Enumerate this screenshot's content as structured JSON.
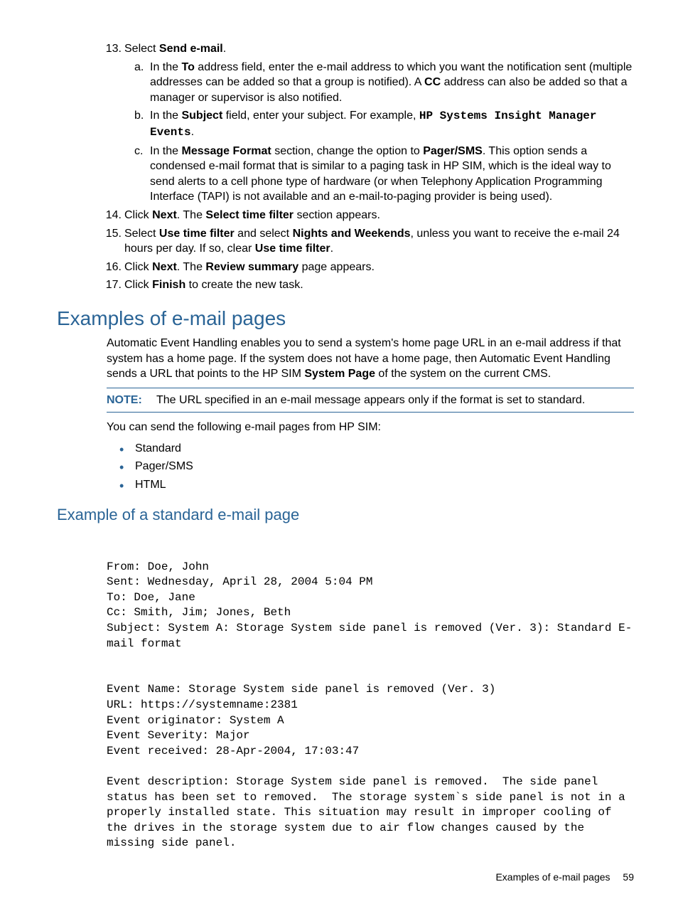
{
  "steps": {
    "s13": {
      "num": "13.",
      "t1": "Select ",
      "b1": "Send e-mail",
      "t2": ".",
      "a": {
        "num": "a.",
        "t1": "In the ",
        "b1": "To",
        "t2": " address field, enter the e-mail address to which you want the notification sent (multiple addresses can be added so that a group is notified). A ",
        "b2": "CC",
        "t3": " address can also be added so that a manager or supervisor is also notified."
      },
      "b": {
        "num": "b.",
        "t1": "In the ",
        "b1": "Subject",
        "t2": " field, enter your subject. For example, ",
        "m1": "HP Systems Insight Manager Events",
        "t3": "."
      },
      "c": {
        "num": "c.",
        "t1": "In the ",
        "b1": "Message Format",
        "t2": " section, change the option to ",
        "b2": "Pager/SMS",
        "t3": ". This option sends a condensed e-mail format that is similar to a paging task in HP SIM, which is the ideal way to send alerts to a cell phone type of hardware (or when Telephony Application Programming Interface (TAPI) is not available and an e-mail-to-paging provider is being used)."
      }
    },
    "s14": {
      "num": "14.",
      "t1": "Click ",
      "b1": "Next",
      "t2": ". The ",
      "b2": "Select time filter",
      "t3": " section appears."
    },
    "s15": {
      "num": "15.",
      "t1": "Select ",
      "b1": "Use time filter",
      "t2": " and select ",
      "b2": "Nights and Weekends",
      "t3": ", unless you want to receive the e-mail 24 hours per day. If so, clear ",
      "b3": "Use time filter",
      "t4": "."
    },
    "s16": {
      "num": "16.",
      "t1": "Click ",
      "b1": "Next",
      "t2": ". The ",
      "b2": "Review summary",
      "t3": " page appears."
    },
    "s17": {
      "num": "17.",
      "t1": "Click ",
      "b1": "Finish",
      "t2": " to create the new task."
    }
  },
  "h2": "Examples of e-mail pages",
  "para1": {
    "t1": "Automatic Event Handling enables you to send a system's home page URL in an e-mail address if that system has a home page. If the system does not have a home page, then Automatic Event Handling sends a URL that points to the HP SIM ",
    "b1": "System Page",
    "t2": " of the system on the current CMS."
  },
  "note": {
    "label": "NOTE:",
    "text": "The URL specified in an e-mail message appears only if the format is set to standard."
  },
  "para2": "You can send the following e-mail pages from HP SIM:",
  "bullets": [
    "Standard",
    "Pager/SMS",
    "HTML"
  ],
  "h3": "Example of a standard e-mail page",
  "email": "From: Doe, John\nSent: Wednesday, April 28, 2004 5:04 PM\nTo: Doe, Jane\nCc: Smith, Jim; Jones, Beth\nSubject: System A: Storage System side panel is removed (Ver. 3): Standard E-mail format\n\n\nEvent Name: Storage System side panel is removed (Ver. 3)\nURL: https://systemname:2381\nEvent originator: System A\nEvent Severity: Major\nEvent received: 28-Apr-2004, 17:03:47\n\nEvent description: Storage System side panel is removed.  The side panel status has been set to removed.  The storage system`s side panel is not in a properly installed state. This situation may result in improper cooling of the drives in the storage system due to air flow changes caused by the missing side panel.",
  "footer": {
    "text": "Examples of e-mail pages",
    "page": "59"
  }
}
